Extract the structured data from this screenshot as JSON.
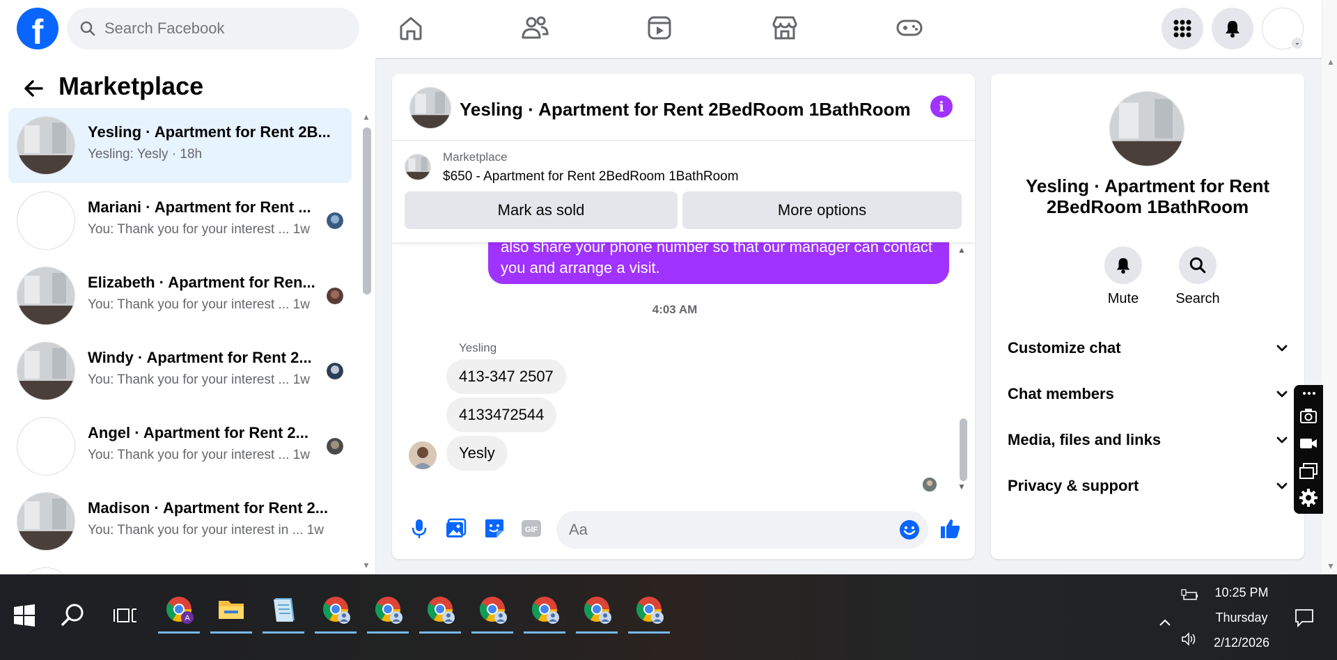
{
  "topnav": {
    "search_placeholder": "Search Facebook"
  },
  "left_panel": {
    "title": "Marketplace",
    "conversations": [
      {
        "name": "Yesling · Apartment for Rent 2B...",
        "sub": "Yesling: Yesly · 18h",
        "active": true
      },
      {
        "name": "Mariani · Apartment for Rent ...",
        "sub": "You: Thank you for your interest ...  1w"
      },
      {
        "name": "Elizabeth · Apartment for Ren...",
        "sub": "You: Thank you for your interest ...  1w"
      },
      {
        "name": "Windy · Apartment for Rent 2...",
        "sub": "You: Thank you for your interest ...  1w"
      },
      {
        "name": "Angel · Apartment for Rent 2...",
        "sub": "You: Thank you for your interest ...  1w"
      },
      {
        "name": "Madison · Apartment for Rent 2...",
        "sub": "You: Thank you for your interest in ...  1w"
      }
    ]
  },
  "chat": {
    "title": "Yesling · Apartment for Rent 2BedRoom 1BathRoom",
    "banner_category": "Marketplace",
    "banner_listing": "$650 - Apartment for Rent 2BedRoom 1BathRoom",
    "mark_sold_label": "Mark as sold",
    "more_options_label": "More options",
    "outgoing_partial": "also share your phone number so that our manager can contact you and arrange a visit.",
    "timestamp": "4:03 AM",
    "sender_name": "Yesling",
    "incoming": [
      "413-347 2507",
      "4133472544",
      "Yesly"
    ],
    "composer_placeholder": "Aa"
  },
  "right_panel": {
    "title": "Yesling · Apartment for Rent 2BedRoom 1BathRoom",
    "mute_label": "Mute",
    "search_label": "Search",
    "sections": [
      "Customize chat",
      "Chat members",
      "Media, files and links",
      "Privacy & support"
    ]
  },
  "taskbar": {
    "time": "10:25 PM",
    "day": "Thursday",
    "date": "2/12/2026"
  },
  "colors": {
    "accent": "#0866ff",
    "bubble_out": "#a033ff",
    "active_conv": "#e7f3ff"
  }
}
